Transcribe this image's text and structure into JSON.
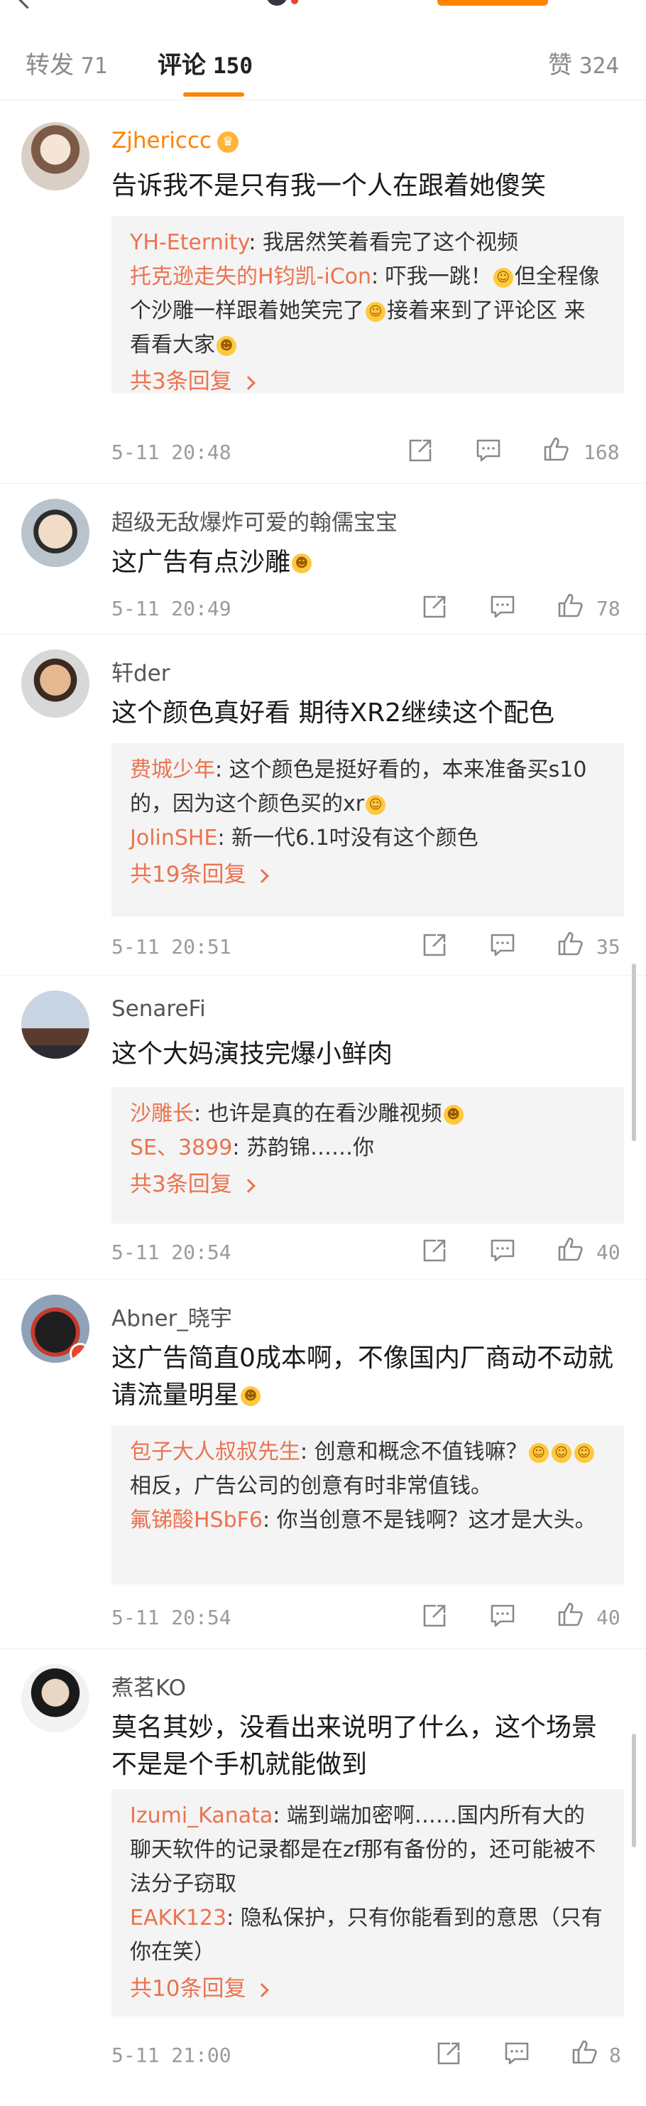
{
  "tabs": {
    "forward": {
      "label": "转发",
      "count": "71"
    },
    "comments": {
      "label": "评论",
      "count": "150"
    },
    "likes": {
      "label": "赞",
      "count": "324"
    }
  },
  "colors": {
    "accent": "#ff8200",
    "link": "#eb7350",
    "reply_bg": "#f4f4f4"
  },
  "comments": [
    {
      "user": "Zjhericcc",
      "text": "告诉我不是只有我一个人在跟着她傻笑",
      "replies": [
        {
          "user": "YH-Eternity",
          "text": ": 我居然笑着看完了这个视频"
        },
        {
          "user": "托克逊走失的H钧凯-iCon",
          "text": ": 吓我一跳！",
          "text2": "但全程像个沙雕一样跟着她笑完了",
          "text3": "接着来到了评论区 来看看大家"
        }
      ],
      "more": "共3条回复",
      "time": "5-11 20:48",
      "likes": "168"
    },
    {
      "user": "超级无敌爆炸可爱的翰儒宝宝",
      "text": "这广告有点沙雕",
      "time": "5-11 20:49",
      "likes": "78"
    },
    {
      "user": "轩der",
      "text": "这个颜色真好看 期待XR2继续这个配色",
      "replies": [
        {
          "user": "费城少年",
          "text": ": 这个颜色是挺好看的，本来准备买s10的，因为这个颜色买的xr"
        },
        {
          "user": "JolinSHE",
          "text": ": 新一代6.1吋没有这个颜色"
        }
      ],
      "more": "共19条回复",
      "time": "5-11 20:51",
      "likes": "35"
    },
    {
      "user": "SenareFi",
      "text": "这个大妈演技完爆小鲜肉",
      "replies": [
        {
          "user": "沙雕长",
          "text": ": 也许是真的在看沙雕视频"
        },
        {
          "user": "SE、3899",
          "text": ": 苏韵锦……你"
        }
      ],
      "more": "共3条回复",
      "time": "5-11 20:54",
      "likes": "40"
    },
    {
      "user": "Abner_晓宇",
      "text": "这广告简直0成本啊，不像国内厂商动不动就请流量明星",
      "replies": [
        {
          "user": "包子大人叔叔先生",
          "text": ": 创意和概念不值钱嘛？",
          "text2": "相反，广告公司的创意有时非常值钱。"
        },
        {
          "user": "氟锑酸HSbF6",
          "text": ": 你当创意不是钱啊？这才是大头。"
        }
      ],
      "time": "5-11 20:54",
      "likes": "40"
    },
    {
      "user": "煮茗KO",
      "text": "莫名其妙，没看出来说明了什么，这个场景不是是个手机就能做到",
      "replies": [
        {
          "user": "Izumi_Kanata",
          "text": ": 端到端加密啊……国内所有大的聊天软件的记录都是在zf那有备份的，还可能被不法分子窃取"
        },
        {
          "user": "EAKK123",
          "text": ": 隐私保护，只有你能看到的意思（只有你在笑）"
        }
      ],
      "more": "共10条回复",
      "time": "5-11 21:00",
      "likes": "8"
    }
  ]
}
